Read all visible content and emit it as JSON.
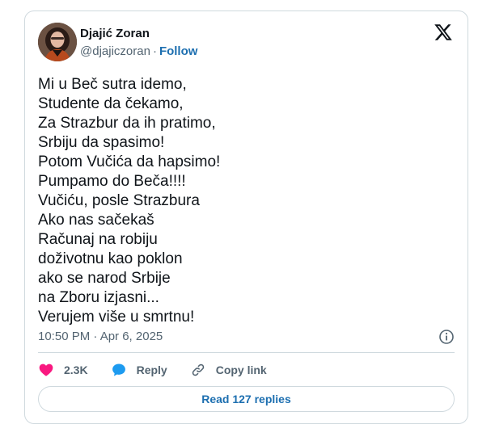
{
  "author": {
    "display_name": "Djajić Zoran",
    "handle": "@djajiczoran",
    "separator": "·",
    "follow_label": "Follow"
  },
  "tweet": {
    "lines": [
      "Mi u Beč sutra idemo,",
      "Studente da čekamo,",
      "Za Strazbur da ih pratimo,",
      "Srbiju da spasimo!",
      "Potom Vučića da hapsimo!",
      "Pumpamo do Beča!!!!",
      "Vučiću, posle Strazbura",
      "Ako nas sačekaš",
      "Računaj na robiju",
      "doživotnu kao poklon",
      "ako se narod Srbije",
      "na Zboru izjasni...",
      "Verujem više u smrtnu!"
    ],
    "timestamp": "10:50 PM · Apr 6, 2025"
  },
  "actions": {
    "like_count": "2.3K",
    "reply_label": "Reply",
    "copy_link_label": "Copy link"
  },
  "footer": {
    "read_replies_label": "Read 127 replies"
  },
  "colors": {
    "like": "#f91880",
    "reply": "#1d9bf0",
    "link": "#1d6fb0",
    "muted": "#536471",
    "border": "#cfd9de"
  },
  "icons": {
    "brand": "x-logo-icon",
    "info": "info-icon",
    "like": "heart-icon",
    "reply": "speech-bubble-icon",
    "copy_link": "link-icon"
  }
}
